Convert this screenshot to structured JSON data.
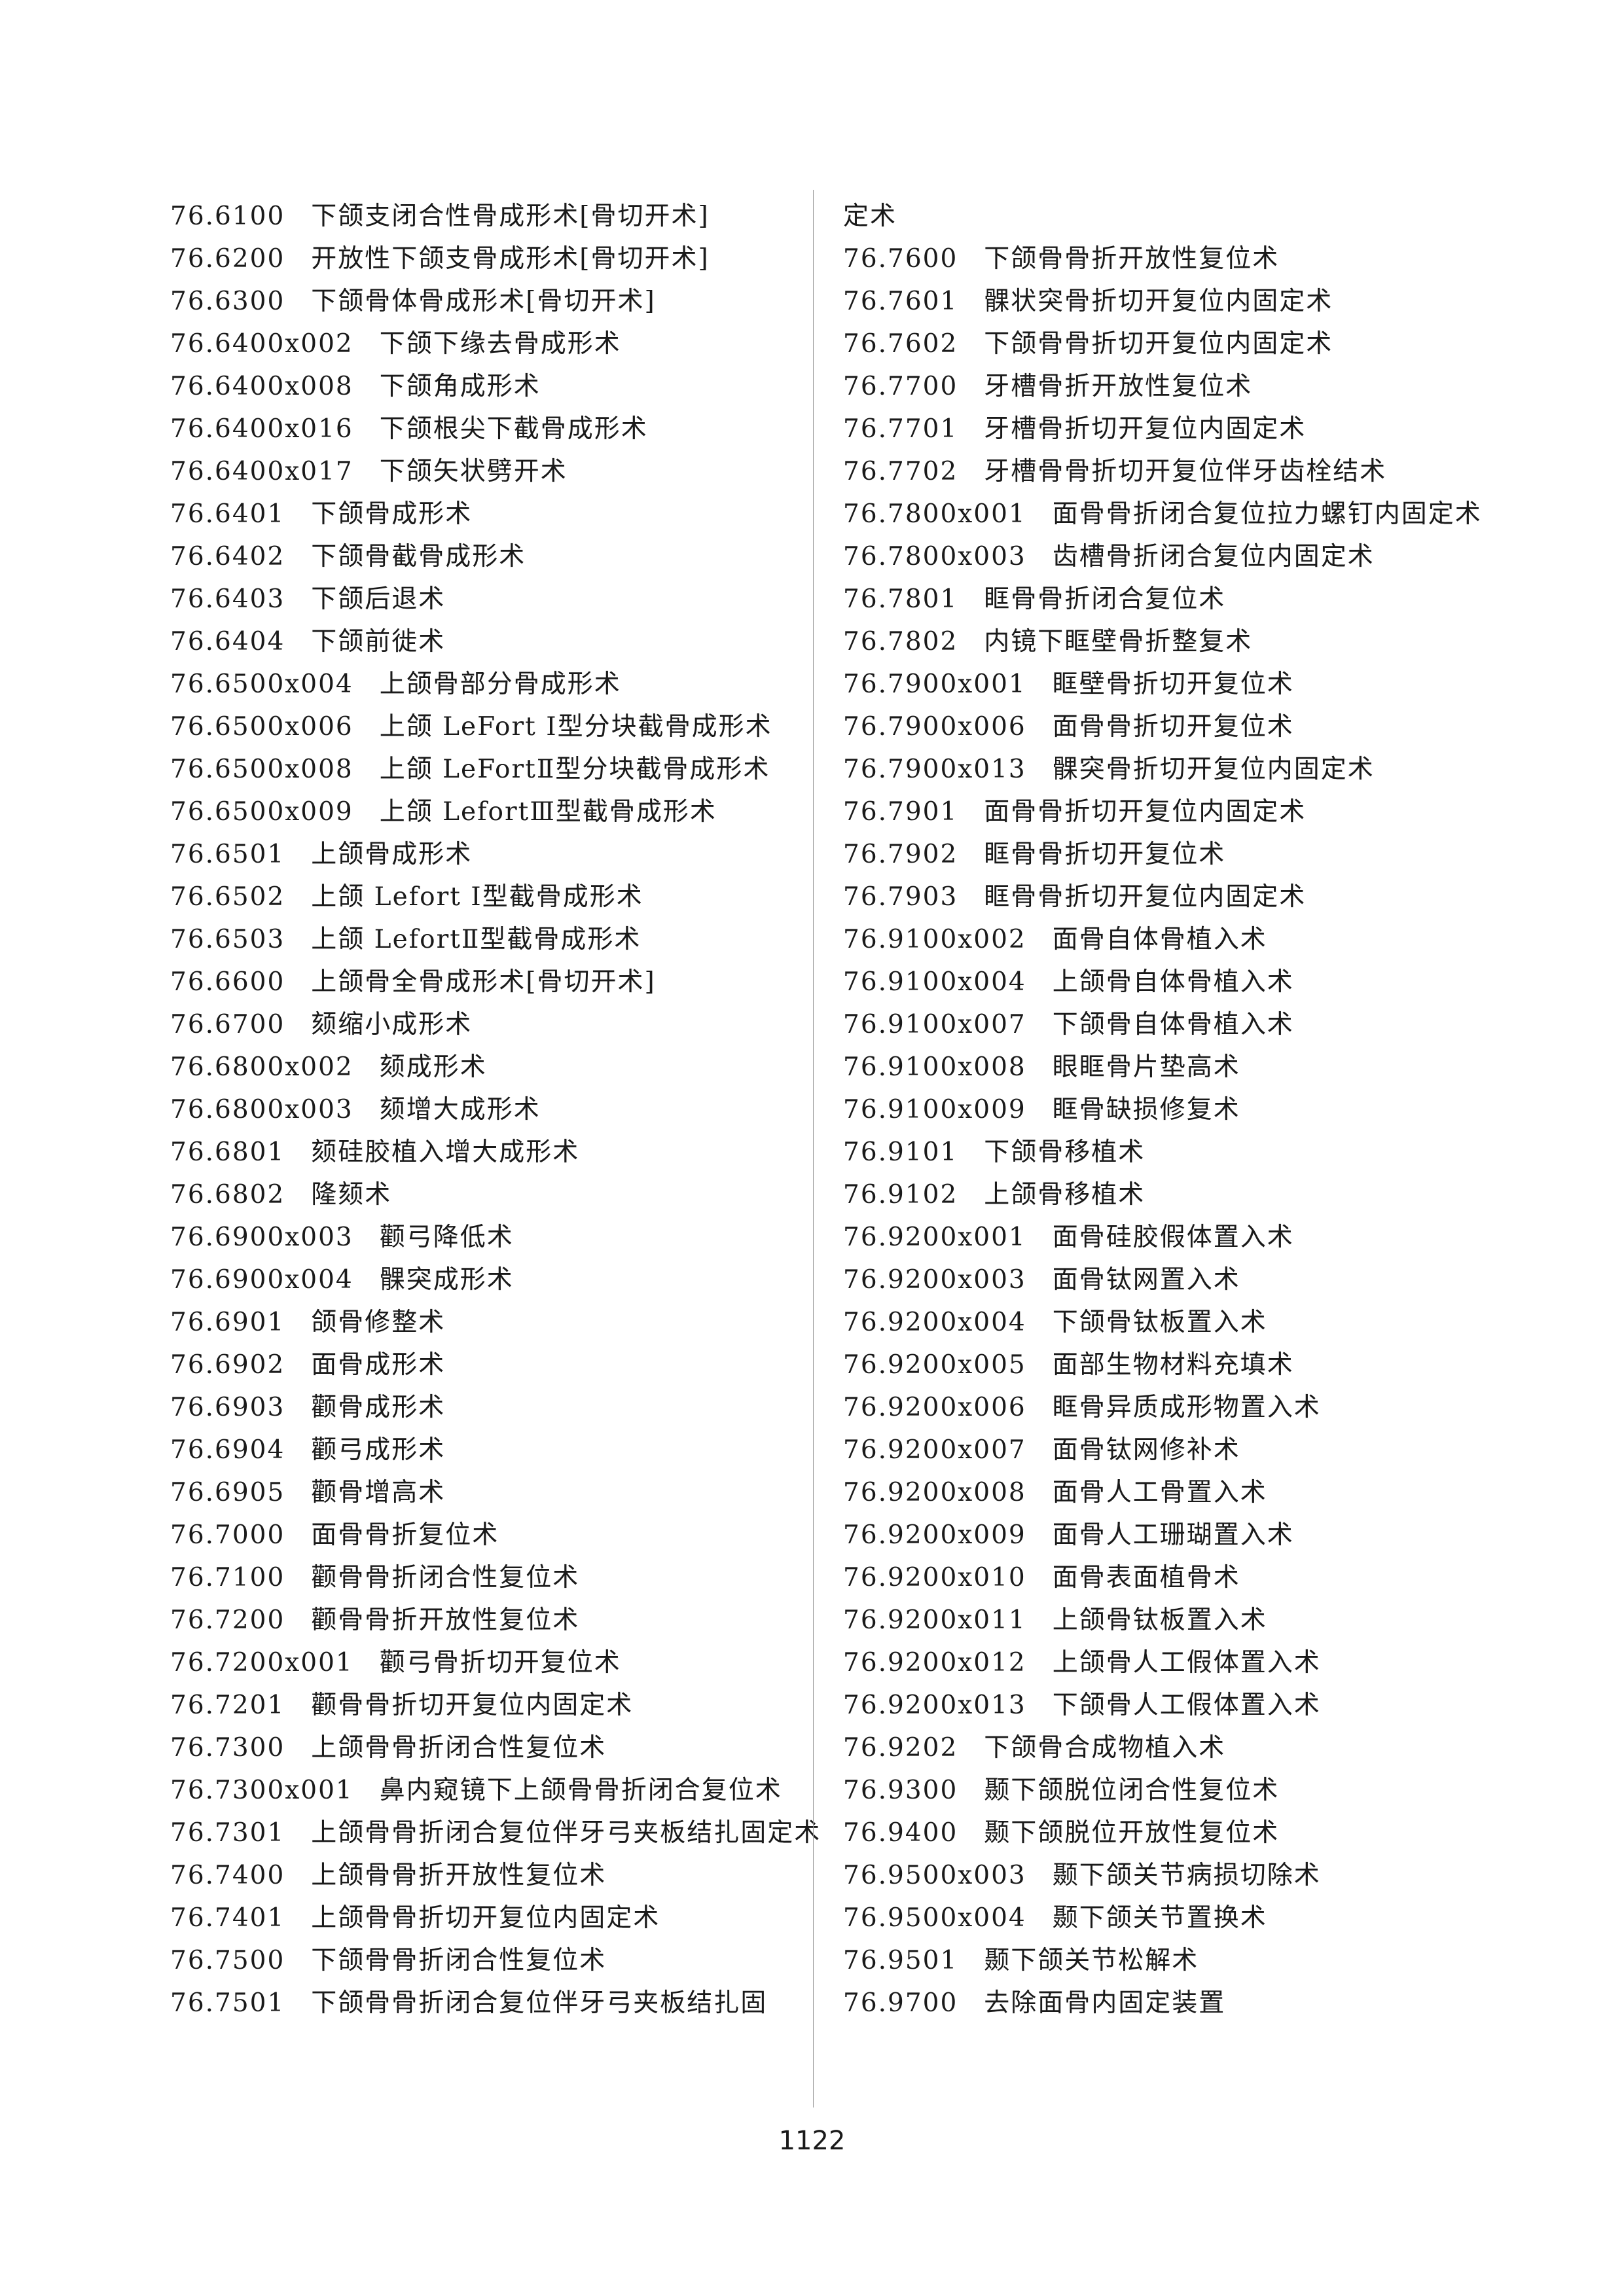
{
  "left_column": [
    {
      "code": "76.6100",
      "name": "下颌支闭合性骨成形术[骨切开术]"
    },
    {
      "code": "76.6200",
      "name": "开放性下颌支骨成形术[骨切开术]"
    },
    {
      "code": "76.6300",
      "name": "下颌骨体骨成形术[骨切开术]"
    },
    {
      "code": "76.6400x002",
      "name": "下颌下缘去骨成形术"
    },
    {
      "code": "76.6400x008",
      "name": "下颌角成形术"
    },
    {
      "code": "76.6400x016",
      "name": "下颌根尖下截骨成形术"
    },
    {
      "code": "76.6400x017",
      "name": "下颌矢状劈开术"
    },
    {
      "code": "76.6401",
      "name": "下颌骨成形术"
    },
    {
      "code": "76.6402",
      "name": "下颌骨截骨成形术"
    },
    {
      "code": "76.6403",
      "name": "下颌后退术"
    },
    {
      "code": "76.6404",
      "name": "下颌前徙术"
    },
    {
      "code": "76.6500x004",
      "name": "上颌骨部分骨成形术"
    },
    {
      "code": "76.6500x006",
      "name": "上颌 LeFort Ⅰ型分块截骨成形术"
    },
    {
      "code": "76.6500x008",
      "name": "上颌 LeFortⅡ型分块截骨成形术"
    },
    {
      "code": "76.6500x009",
      "name": "上颌 LefortⅢ型截骨成形术"
    },
    {
      "code": "76.6501",
      "name": "上颌骨成形术"
    },
    {
      "code": "76.6502",
      "name": "上颌 Lefort Ⅰ型截骨成形术"
    },
    {
      "code": "76.6503",
      "name": "上颌 LefortⅡ型截骨成形术"
    },
    {
      "code": "76.6600",
      "name": "上颌骨全骨成形术[骨切开术]"
    },
    {
      "code": "76.6700",
      "name": "颏缩小成形术"
    },
    {
      "code": "76.6800x002",
      "name": "颏成形术"
    },
    {
      "code": "76.6800x003",
      "name": "颏增大成形术"
    },
    {
      "code": "76.6801",
      "name": "颏硅胶植入增大成形术"
    },
    {
      "code": "76.6802",
      "name": "隆颏术"
    },
    {
      "code": "76.6900x003",
      "name": "颧弓降低术"
    },
    {
      "code": "76.6900x004",
      "name": "髁突成形术"
    },
    {
      "code": "76.6901",
      "name": "颌骨修整术"
    },
    {
      "code": "76.6902",
      "name": "面骨成形术"
    },
    {
      "code": "76.6903",
      "name": "颧骨成形术"
    },
    {
      "code": "76.6904",
      "name": "颧弓成形术"
    },
    {
      "code": "76.6905",
      "name": "颧骨增高术"
    },
    {
      "code": "76.7000",
      "name": "面骨骨折复位术"
    },
    {
      "code": "76.7100",
      "name": "颧骨骨折闭合性复位术"
    },
    {
      "code": "76.7200",
      "name": "颧骨骨折开放性复位术"
    },
    {
      "code": "76.7200x001",
      "name": "颧弓骨折切开复位术"
    },
    {
      "code": "76.7201",
      "name": "颧骨骨折切开复位内固定术"
    },
    {
      "code": "76.7300",
      "name": "上颌骨骨折闭合性复位术"
    },
    {
      "code": "76.7300x001",
      "name": "鼻内窥镜下上颌骨骨折闭合复位术"
    },
    {
      "code": "76.7301",
      "name": "上颌骨骨折闭合复位伴牙弓夹板结扎固定术"
    },
    {
      "code": "76.7400",
      "name": "上颌骨骨折开放性复位术"
    },
    {
      "code": "76.7401",
      "name": "上颌骨骨折切开复位内固定术"
    },
    {
      "code": "76.7500",
      "name": "下颌骨骨折闭合性复位术"
    },
    {
      "code": "76.7501",
      "name": "下颌骨骨折闭合复位伴牙弓夹板结扎固"
    }
  ],
  "right_column": [
    {
      "code": "",
      "name": "定术"
    },
    {
      "code": "76.7600",
      "name": "下颌骨骨折开放性复位术"
    },
    {
      "code": "76.7601",
      "name": "髁状突骨折切开复位内固定术"
    },
    {
      "code": "76.7602",
      "name": "下颌骨骨折切开复位内固定术"
    },
    {
      "code": "76.7700",
      "name": "牙槽骨折开放性复位术"
    },
    {
      "code": "76.7701",
      "name": "牙槽骨折切开复位内固定术"
    },
    {
      "code": "76.7702",
      "name": "牙槽骨骨折切开复位伴牙齿栓结术"
    },
    {
      "code": "76.7800x001",
      "name": "面骨骨折闭合复位拉力螺钉内固定术"
    },
    {
      "code": "76.7800x003",
      "name": "齿槽骨折闭合复位内固定术"
    },
    {
      "code": "76.7801",
      "name": "眶骨骨折闭合复位术"
    },
    {
      "code": "76.7802",
      "name": "内镜下眶壁骨折整复术"
    },
    {
      "code": "76.7900x001",
      "name": "眶壁骨折切开复位术"
    },
    {
      "code": "76.7900x006",
      "name": "面骨骨折切开复位术"
    },
    {
      "code": "76.7900x013",
      "name": "髁突骨折切开复位内固定术"
    },
    {
      "code": "76.7901",
      "name": "面骨骨折切开复位内固定术"
    },
    {
      "code": "76.7902",
      "name": "眶骨骨折切开复位术"
    },
    {
      "code": "76.7903",
      "name": "眶骨骨折切开复位内固定术"
    },
    {
      "code": "76.9100x002",
      "name": "面骨自体骨植入术"
    },
    {
      "code": "76.9100x004",
      "name": "上颌骨自体骨植入术"
    },
    {
      "code": "76.9100x007",
      "name": "下颌骨自体骨植入术"
    },
    {
      "code": "76.9100x008",
      "name": "眼眶骨片垫高术"
    },
    {
      "code": "76.9100x009",
      "name": "眶骨缺损修复术"
    },
    {
      "code": "76.9101",
      "name": "下颌骨移植术"
    },
    {
      "code": "76.9102",
      "name": "上颌骨移植术"
    },
    {
      "code": "76.9200x001",
      "name": "面骨硅胶假体置入术"
    },
    {
      "code": "76.9200x003",
      "name": "面骨钛网置入术"
    },
    {
      "code": "76.9200x004",
      "name": "下颌骨钛板置入术"
    },
    {
      "code": "76.9200x005",
      "name": "面部生物材料充填术"
    },
    {
      "code": "76.9200x006",
      "name": "眶骨异质成形物置入术"
    },
    {
      "code": "76.9200x007",
      "name": "面骨钛网修补术"
    },
    {
      "code": "76.9200x008",
      "name": "面骨人工骨置入术"
    },
    {
      "code": "76.9200x009",
      "name": "面骨人工珊瑚置入术"
    },
    {
      "code": "76.9200x010",
      "name": "面骨表面植骨术"
    },
    {
      "code": "76.9200x011",
      "name": "上颌骨钛板置入术"
    },
    {
      "code": "76.9200x012",
      "name": "上颌骨人工假体置入术"
    },
    {
      "code": "76.9200x013",
      "name": "下颌骨人工假体置入术"
    },
    {
      "code": "76.9202",
      "name": "下颌骨合成物植入术"
    },
    {
      "code": "76.9300",
      "name": "颞下颌脱位闭合性复位术"
    },
    {
      "code": "76.9400",
      "name": "颞下颌脱位开放性复位术"
    },
    {
      "code": "76.9500x003",
      "name": "颞下颌关节病损切除术"
    },
    {
      "code": "76.9500x004",
      "name": "颞下颌关节置换术"
    },
    {
      "code": "76.9501",
      "name": "颞下颌关节松解术"
    },
    {
      "code": "76.9700",
      "name": "去除面骨内固定装置"
    }
  ],
  "page_number": "1122"
}
